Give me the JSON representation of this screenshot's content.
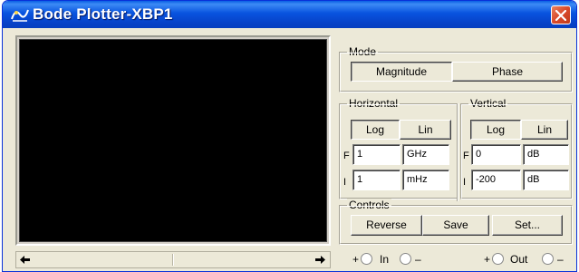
{
  "window": {
    "title": "Bode Plotter-XBP1",
    "icon": "bode-plotter-icon",
    "close_icon": "close-icon"
  },
  "mode": {
    "legend": "Mode",
    "magnitude_label": "Magnitude",
    "phase_label": "Phase",
    "selected": "Magnitude"
  },
  "horizontal": {
    "legend": "Horizontal",
    "log_label": "Log",
    "lin_label": "Lin",
    "selected": "Log",
    "final_label": "F",
    "final_value": "1",
    "final_unit": "GHz",
    "initial_label": "I",
    "initial_value": "1",
    "initial_unit": "mHz"
  },
  "vertical": {
    "legend": "Vertical",
    "log_label": "Log",
    "lin_label": "Lin",
    "selected": "Log",
    "final_label": "F",
    "final_value": "0",
    "final_unit": "dB",
    "initial_label": "I",
    "initial_value": "-200",
    "initial_unit": "dB"
  },
  "controls": {
    "legend": "Controls",
    "reverse_label": "Reverse",
    "save_label": "Save",
    "set_label": "Set..."
  },
  "terminals": {
    "in_plus": "+",
    "in_label": "In",
    "in_minus": "–",
    "out_plus": "+",
    "out_label": "Out",
    "out_minus": "–"
  },
  "colors": {
    "titlebar": "#0853df",
    "plot_background": "#000000",
    "window_face": "#ece9d8",
    "close_button": "#d9492a"
  }
}
